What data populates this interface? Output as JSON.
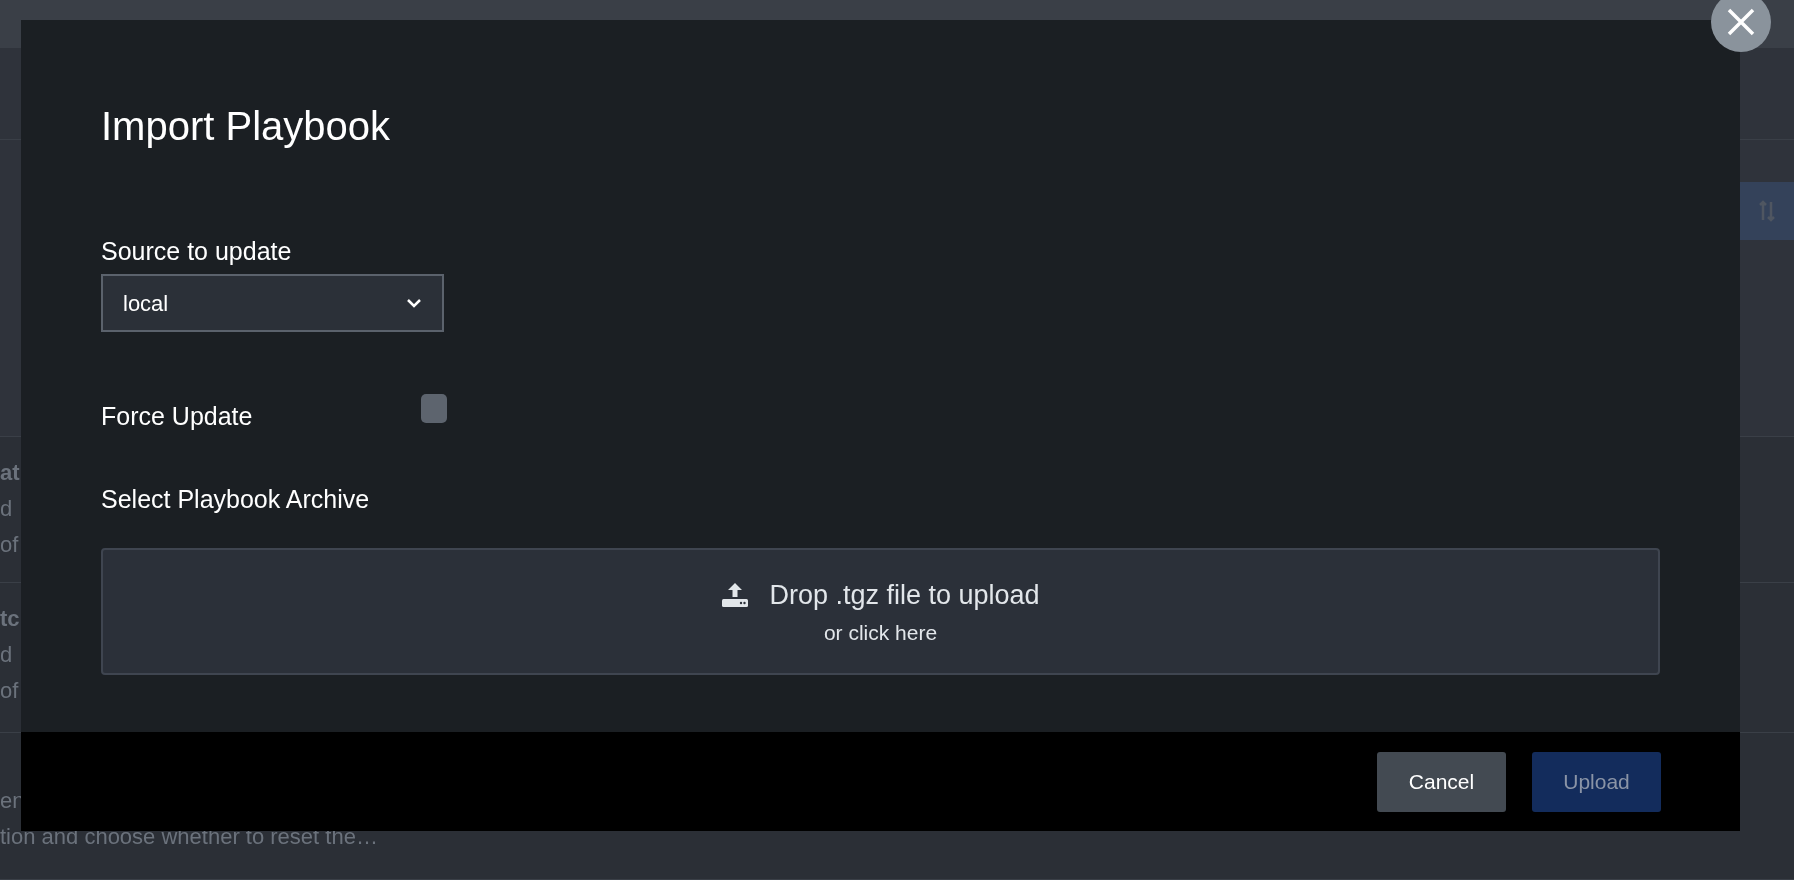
{
  "background": {
    "rows": [
      {
        "title": "at",
        "lines": [
          "d",
          "of"
        ]
      },
      {
        "title": "tc",
        "lines": [
          "d",
          "of"
        ]
      },
      {
        "lines": [
          "en",
          "tion and choose whether to reset the…"
        ]
      }
    ]
  },
  "dialog": {
    "title": "Import Playbook",
    "source": {
      "label": "Source to update",
      "value": "local"
    },
    "force_update": {
      "label": "Force Update",
      "checked": false
    },
    "archive": {
      "label": "Select Playbook Archive",
      "drop_text": "Drop .tgz file to upload",
      "click_text": "or click here"
    },
    "buttons": [
      {
        "label": "Cancel",
        "kind": "secondary",
        "disabled": false
      },
      {
        "label": "Upload",
        "kind": "primary",
        "disabled": true
      }
    ]
  }
}
